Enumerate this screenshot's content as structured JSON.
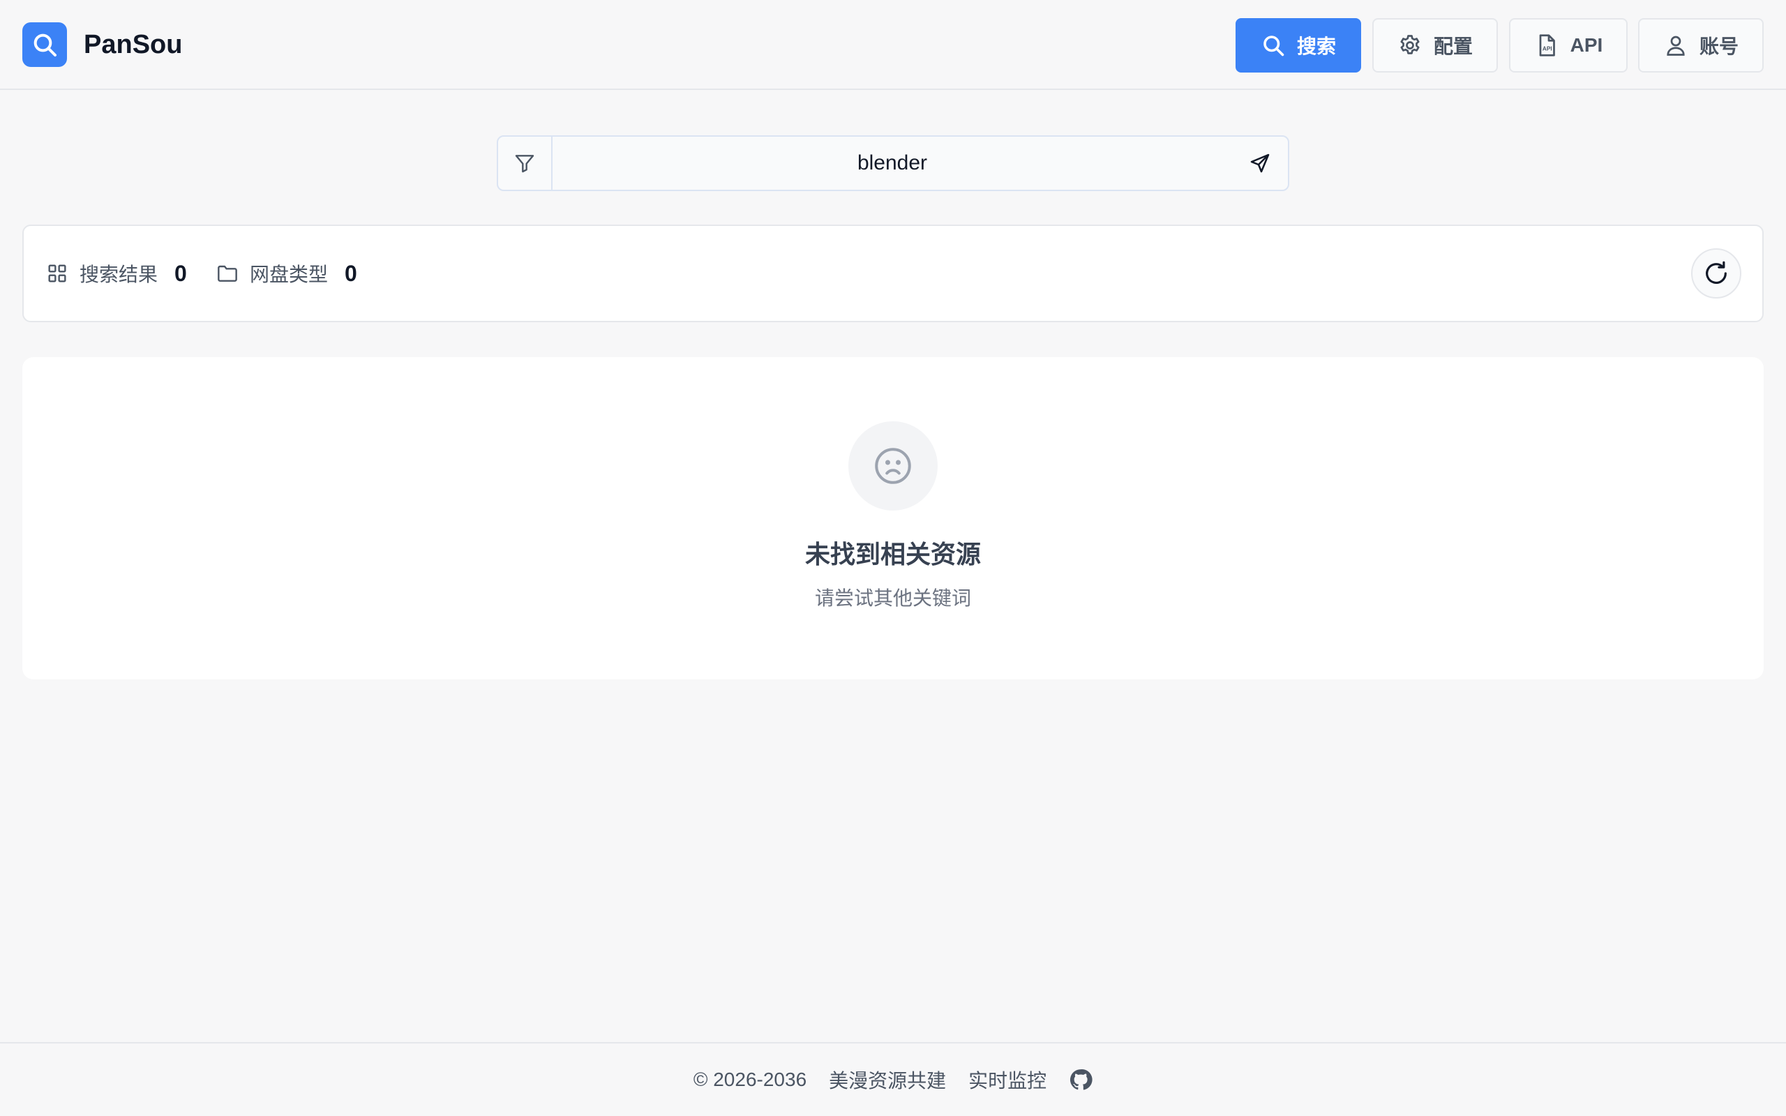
{
  "header": {
    "brand": "PanSou",
    "nav": [
      {
        "label": "搜索",
        "icon": "search-icon",
        "active": true
      },
      {
        "label": "配置",
        "icon": "gear-icon",
        "active": false
      },
      {
        "label": "API",
        "icon": "api-file-icon",
        "active": false
      },
      {
        "label": "账号",
        "icon": "user-icon",
        "active": false
      }
    ]
  },
  "search": {
    "value": "blender",
    "filter_icon": "filter-icon",
    "send_icon": "send-icon"
  },
  "stats": {
    "results_label": "搜索结果",
    "results_value": "0",
    "types_label": "网盘类型",
    "types_value": "0"
  },
  "empty": {
    "icon": "sad-face-icon",
    "title": "未找到相关资源",
    "subtitle": "请尝试其他关键词"
  },
  "footer": {
    "copyright": "© 2026-2036",
    "link1": "美漫资源共建",
    "link2": "实时监控",
    "github_icon": "github-icon"
  },
  "colors": {
    "accent": "#3b82f6",
    "background": "#f7f7f8",
    "card": "#ffffff",
    "border": "#e5e7eb"
  }
}
